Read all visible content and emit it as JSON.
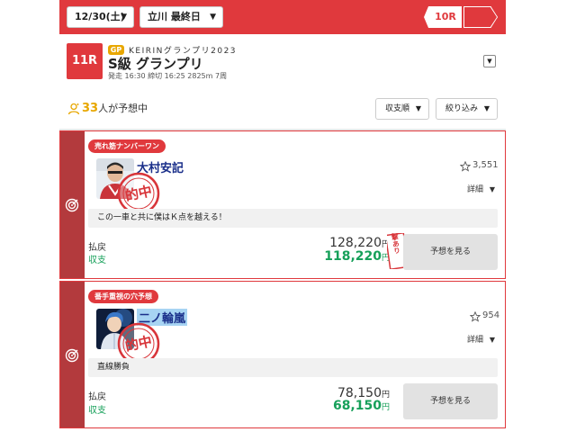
{
  "header": {
    "date_select": "12/30(土)",
    "venue_select": "立川 最終日",
    "race_nav_label": "10R"
  },
  "race": {
    "number": "11R",
    "grade_tag": "GP",
    "event_name": "KEIRINグランプリ2023",
    "title": "S級 グランプリ",
    "meta": "発走 16:30 締切 16:25 2825m 7周"
  },
  "summary": {
    "count": "33",
    "count_suffix": "人が予想中",
    "sort_label": "収支順",
    "filter_label": "絞り込み"
  },
  "cards": [
    {
      "tag": "売れ筋ナンバーワン",
      "name": "大村安記",
      "favorites": "3,551",
      "detail_label": "詳細",
      "comment": "この一車と共に僕はＫ点を越える！",
      "payout_label": "払戻",
      "payout_value": "128,220",
      "balance_label": "収支",
      "balance_value": "118,220",
      "yen": "円",
      "view_label": "予想を見る",
      "memo_badge": "目撃あり",
      "stamp_text": "的中"
    },
    {
      "tag": "番手重視の穴予想",
      "name": "二ノ輪嵐",
      "favorites": "954",
      "detail_label": "詳細",
      "comment": "直線勝負",
      "payout_label": "払戻",
      "payout_value": "78,150",
      "balance_label": "収支",
      "balance_value": "68,150",
      "yen": "円",
      "view_label": "予想を見る",
      "stamp_text": "的中"
    }
  ],
  "colors": {
    "brand_red": "#e0393d",
    "stripe_red": "#b33a3d",
    "gold": "#e8a700",
    "profit_green": "#17a05a",
    "name_navy": "#1a2f8a"
  }
}
